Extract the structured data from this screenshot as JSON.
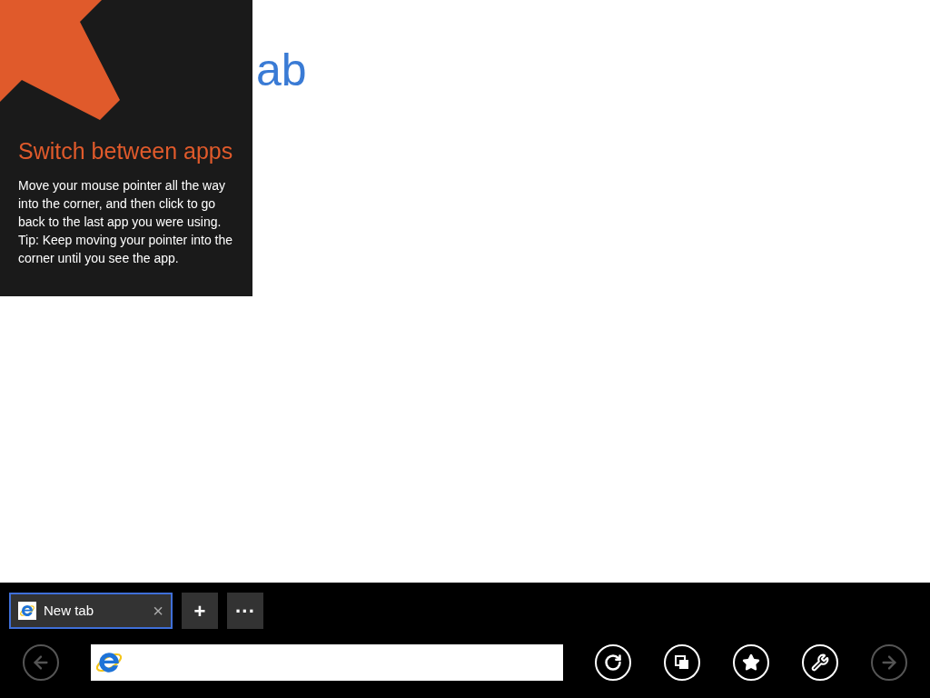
{
  "page": {
    "heading": "ab"
  },
  "tip": {
    "title": "Switch between apps",
    "body": "Move your mouse pointer all the way into the corner, and then click to go back to the last app you were using.",
    "hint": "Tip: Keep moving your pointer into the corner until you see the app."
  },
  "tabs": [
    {
      "label": "New tab",
      "close": "×",
      "selected": true
    }
  ],
  "tab_actions": [
    "+",
    "···"
  ],
  "nav": {
    "back": {
      "disabled": true
    },
    "forward": {
      "disabled": true
    }
  },
  "toolbar": [
    {
      "kind": "refresh"
    },
    {
      "kind": "tabs"
    },
    {
      "kind": "pin"
    },
    {
      "kind": "tools"
    }
  ]
}
